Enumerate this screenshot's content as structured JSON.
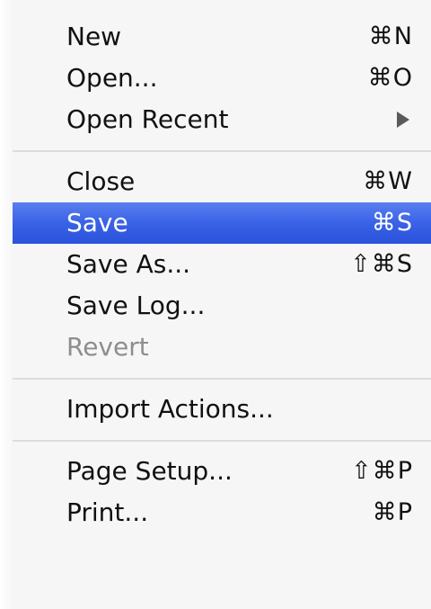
{
  "menu": {
    "groups": [
      {
        "items": [
          {
            "label": "New",
            "shortcut": "⌘N"
          },
          {
            "label": "Open...",
            "shortcut": "⌘O"
          },
          {
            "label": "Open Recent",
            "shortcut": ""
          }
        ]
      },
      {
        "items": [
          {
            "label": "Close",
            "shortcut": "⌘W"
          },
          {
            "label": "Save",
            "shortcut": "⌘S"
          },
          {
            "label": "Save As...",
            "shortcut": "⇧⌘S"
          },
          {
            "label": "Save Log...",
            "shortcut": ""
          },
          {
            "label": "Revert",
            "shortcut": ""
          }
        ]
      },
      {
        "items": [
          {
            "label": "Import Actions...",
            "shortcut": ""
          }
        ]
      },
      {
        "items": [
          {
            "label": "Page Setup...",
            "shortcut": "⇧⌘P"
          },
          {
            "label": "Print...",
            "shortcut": "⌘P"
          }
        ]
      }
    ],
    "highlighted_item": "Save",
    "disabled_items": [
      "Revert"
    ],
    "colors": {
      "highlight": "#3a62e6",
      "disabled_text": "#8e8e8e",
      "background": "#f6f6f6"
    },
    "icons": {
      "open_recent_submenu": "submenu-arrow-icon"
    }
  }
}
